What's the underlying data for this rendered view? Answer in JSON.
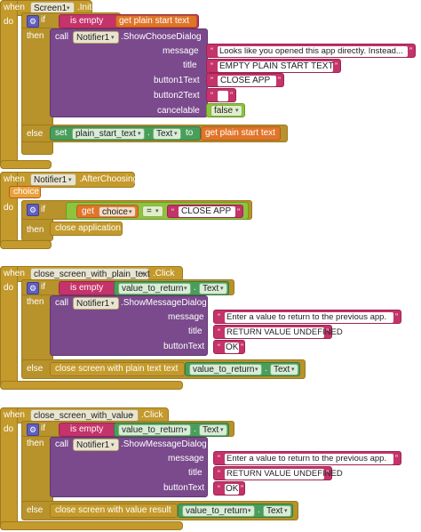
{
  "common": {
    "when": "when",
    "do": "do",
    "if": "if",
    "then": "then",
    "else": "else",
    "call": "call",
    "set": "set",
    "to": "to",
    "dot": ".",
    "open_quote": "“",
    "close_quote": "”",
    "dropdown_arrow": "▾"
  },
  "icons": {
    "gear": "gear-icon",
    "dropdown": "chevron-down-icon"
  },
  "colors": {
    "event": "#c49a2c",
    "method": "#7a4a8c",
    "text": "#c4336a",
    "logic": "#8ec43c",
    "variable": "#e0752a",
    "component": "#4a9e5c"
  },
  "block1": {
    "component": "Screen1",
    "event": ".Initialize",
    "is_empty": "is empty",
    "get_plain_start_text": "get plain start text",
    "notifier": "Notifier1",
    "method": ".ShowChooseDialog",
    "params": [
      {
        "label": "message",
        "value": "Looks like you opened this app directly. Instead..."
      },
      {
        "label": "title",
        "value": "EMPTY PLAIN START TEXT"
      },
      {
        "label": "button1Text",
        "value": "CLOSE APP"
      },
      {
        "label": "button2Text",
        "value": ""
      },
      {
        "label": "cancelable",
        "value": "false"
      }
    ],
    "setter_property": "plain_start_text",
    "setter_type": "Text",
    "set_value": "get plain start text"
  },
  "block2": {
    "component": "Notifier1",
    "event": ".AfterChoosing",
    "param": "choice",
    "get": "get",
    "get_var": "choice",
    "eq": "=",
    "compare_value": "CLOSE APP",
    "close_application": "close application"
  },
  "block3": {
    "component": "close_screen_with_plain_text",
    "event": ".Click",
    "is_empty": "is empty",
    "value_prop": "value_to_return",
    "value_type": "Text",
    "notifier": "Notifier1",
    "method": ".ShowMessageDialog",
    "params": [
      {
        "label": "message",
        "value": "Enter a value to return to the previous app."
      },
      {
        "label": "title",
        "value": "RETURN VALUE UNDEFINED"
      },
      {
        "label": "buttonText",
        "value": "OK"
      }
    ],
    "close_label": "close screen with plain text  text",
    "close_prop": "value_to_return",
    "close_type": "Text"
  },
  "block4": {
    "component": "close_screen_with_value",
    "event": ".Click",
    "is_empty": "is empty",
    "value_prop": "value_to_return",
    "value_type": "Text",
    "notifier": "Notifier1",
    "method": ".ShowMessageDialog",
    "params": [
      {
        "label": "message",
        "value": "Enter a value to return to the previous app."
      },
      {
        "label": "title",
        "value": "RETURN VALUE UNDEFINED"
      },
      {
        "label": "buttonText",
        "value": "OK"
      }
    ],
    "close_label": "close screen with value  result",
    "close_prop": "value_to_return",
    "close_type": "Text"
  }
}
